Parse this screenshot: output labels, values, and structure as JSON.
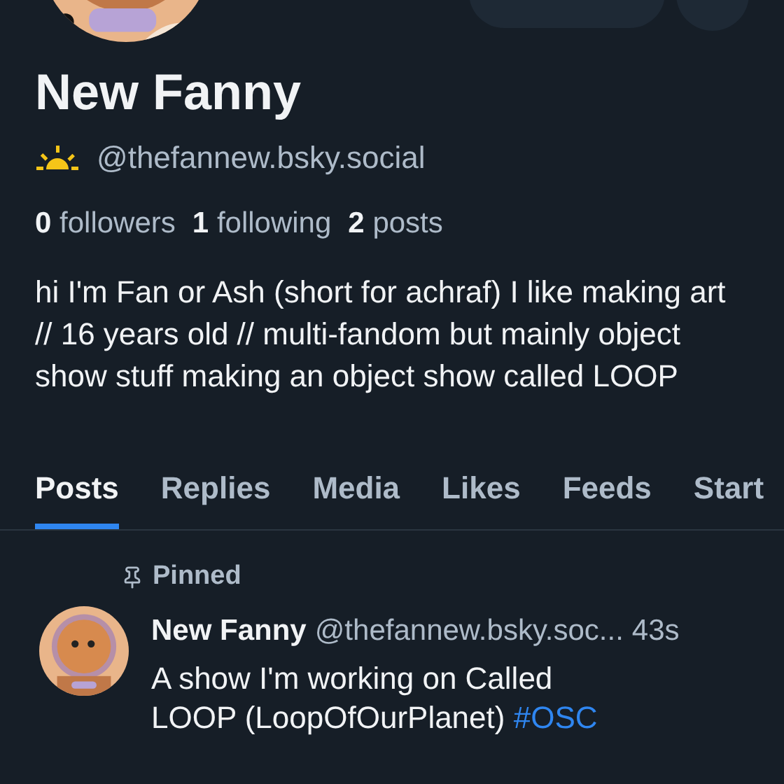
{
  "profile": {
    "name": "New Fanny",
    "handle": "@thefannew.bsky.social",
    "stats": [
      {
        "count": "0",
        "label": "followers"
      },
      {
        "count": "1",
        "label": "following"
      },
      {
        "count": "2",
        "label": "posts"
      }
    ],
    "bio": "hi I'm Fan or Ash (short for achraf) I like making art // 16 years old // multi-fandom but mainly object show stuff making an object show called LOOP"
  },
  "tabs": [
    {
      "label": "Posts",
      "selected": true
    },
    {
      "label": "Replies",
      "selected": false
    },
    {
      "label": "Media",
      "selected": false
    },
    {
      "label": "Likes",
      "selected": false
    },
    {
      "label": "Feeds",
      "selected": false
    },
    {
      "label": "Start",
      "selected": false
    }
  ],
  "post": {
    "pinned_label": "Pinned",
    "author": "New Fanny",
    "handle": "@thefannew.bsky.soc...",
    "time": "43s",
    "text": "A show I'm working on Called LOOP (LoopOfOurPlanet) **#OSC**"
  }
}
